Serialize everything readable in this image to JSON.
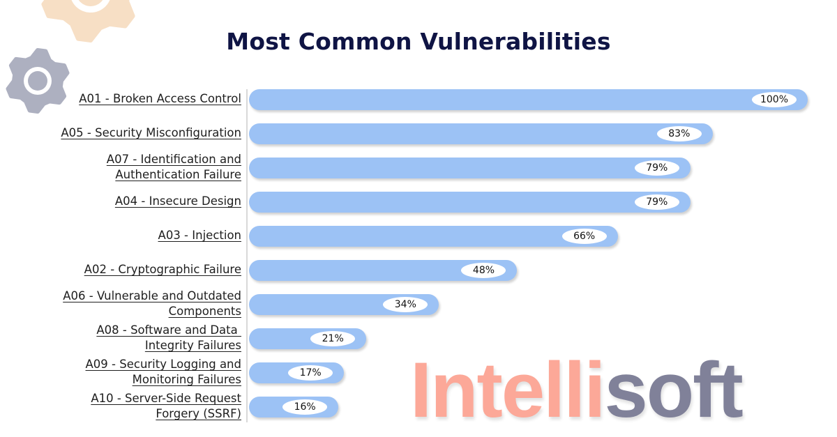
{
  "header": {
    "title": "Most Common Vulnerabilities"
  },
  "brand": {
    "part1": "Intelli",
    "part2": "soft",
    "color1": "#fca898",
    "color2": "#808199"
  },
  "decor": {
    "gear_top_color": "#f7dfc5",
    "gear_left_color": "#adb0c0"
  },
  "colors": {
    "bar": "#9cc2f5",
    "title": "#0f1444",
    "pill": "#ffffff"
  },
  "chart_data": {
    "type": "bar",
    "orientation": "horizontal",
    "title": "Most Common Vulnerabilities",
    "xlabel": "",
    "ylabel": "",
    "xlim": [
      0,
      100
    ],
    "grid": false,
    "legend": "none",
    "categories": [
      [
        "A01 - Broken Access Control"
      ],
      [
        "A05 - Security Misconfiguration"
      ],
      [
        "A07 - Identification and",
        "Authentication Failure"
      ],
      [
        "A04 - Insecure Design"
      ],
      [
        "A03 - Injection"
      ],
      [
        "A02 - Cryptographic Failure"
      ],
      [
        "A06 - Vulnerable and Outdated",
        "Components"
      ],
      [
        "A08 - Software and Data ",
        "Integrity Failures"
      ],
      [
        "A09 - Security Logging and",
        "Monitoring Failures"
      ],
      [
        "A10 - Server-Side Request",
        "Forgery (SSRF)"
      ]
    ],
    "values": [
      100,
      83,
      79,
      79,
      66,
      48,
      34,
      21,
      17,
      16
    ],
    "data_labels": [
      "100%",
      "83%",
      "79%",
      "79%",
      "66%",
      "48%",
      "34%",
      "21%",
      "17%",
      "16%"
    ]
  }
}
